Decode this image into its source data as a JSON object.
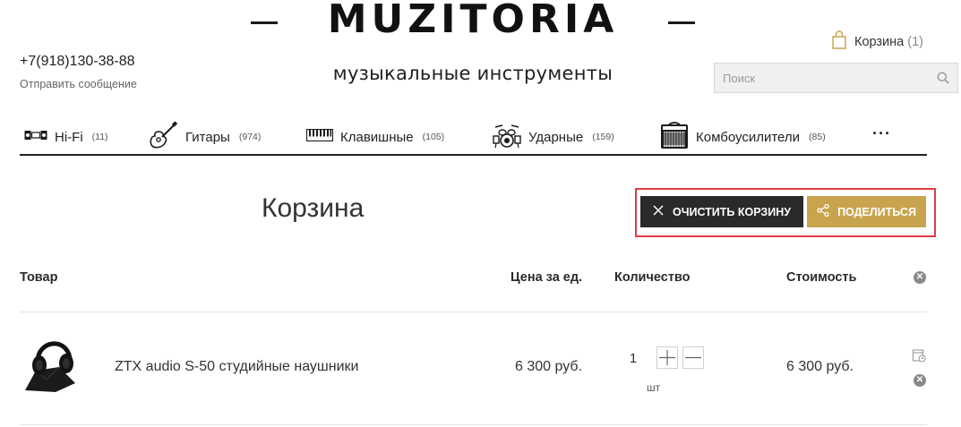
{
  "brand": {
    "logo": "MUZITORIA",
    "tagline": "музыкальные инструменты"
  },
  "contact": {
    "phone": "+7(918)130-38-88",
    "send_message": "Отправить сообщение"
  },
  "cart_link": {
    "label": "Корзина",
    "count": "(1)"
  },
  "search": {
    "placeholder": "Поиск",
    "value": ""
  },
  "nav": {
    "items": [
      {
        "label": "Hi-Fi",
        "count": "(11)",
        "icon": "hifi-stereo-icon"
      },
      {
        "label": "Гитары",
        "count": "(974)",
        "icon": "guitar-icon"
      },
      {
        "label": "Клавишные",
        "count": "(105)",
        "icon": "piano-keys-icon"
      },
      {
        "label": "Ударные",
        "count": "(159)",
        "icon": "drum-kit-icon"
      },
      {
        "label": "Комбоусилители",
        "count": "(85)",
        "icon": "amplifier-icon"
      }
    ],
    "more": "···"
  },
  "page": {
    "title": "Корзина"
  },
  "actions": {
    "clear": "ОЧИСТИТЬ КОРЗИНУ",
    "share": "ПОДЕЛИТЬСЯ"
  },
  "colors": {
    "accent": "#c9a44e",
    "dark": "#2a2a2a",
    "highlight": "#e23b44"
  },
  "table": {
    "headers": {
      "product": "Товар",
      "unit_price": "Цена за ед.",
      "quantity": "Количество",
      "cost": "Стоимость"
    },
    "rows": [
      {
        "name": "ZTX audio S-50 студийные наушники",
        "unit_price": "6 300 руб.",
        "quantity": "1",
        "unit": "шт",
        "cost": "6 300 руб."
      }
    ]
  }
}
